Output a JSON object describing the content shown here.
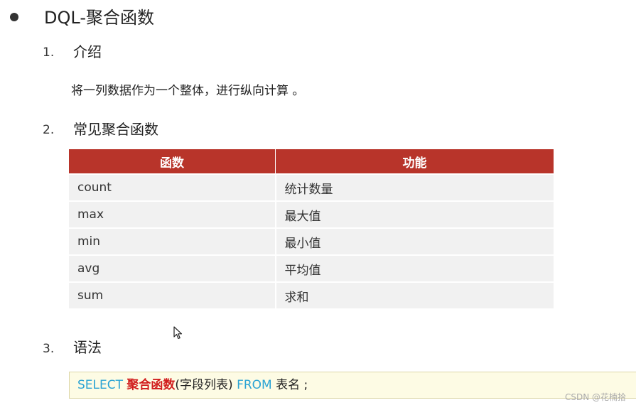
{
  "title": "DQL-聚合函数",
  "sections": [
    {
      "number": "1.",
      "heading": "介绍"
    },
    {
      "number": "2.",
      "heading": "常见聚合函数"
    },
    {
      "number": "3.",
      "heading": "语法"
    }
  ],
  "intro_text": "将一列数据作为一个整体，进行纵向计算 。",
  "table": {
    "headers": [
      "函数",
      "功能"
    ],
    "rows": [
      [
        "count",
        "统计数量"
      ],
      [
        "max",
        "最大值"
      ],
      [
        "min",
        "最小值"
      ],
      [
        "avg",
        "平均值"
      ],
      [
        "sum",
        "求和"
      ]
    ]
  },
  "syntax": {
    "select_kw": "SELECT",
    "func": "聚合函数",
    "args": "(字段列表)",
    "from_kw": "FROM",
    "tail": "表名 ;"
  },
  "watermark": "CSDN @花楠拾",
  "colors": {
    "table_header": "#b8342a",
    "keyword": "#2aa3d4",
    "function": "#d11d1d",
    "syntax_bg": "#fdfbe4"
  },
  "icons": [
    "bullet-icon",
    "mouse-cursor-icon"
  ]
}
